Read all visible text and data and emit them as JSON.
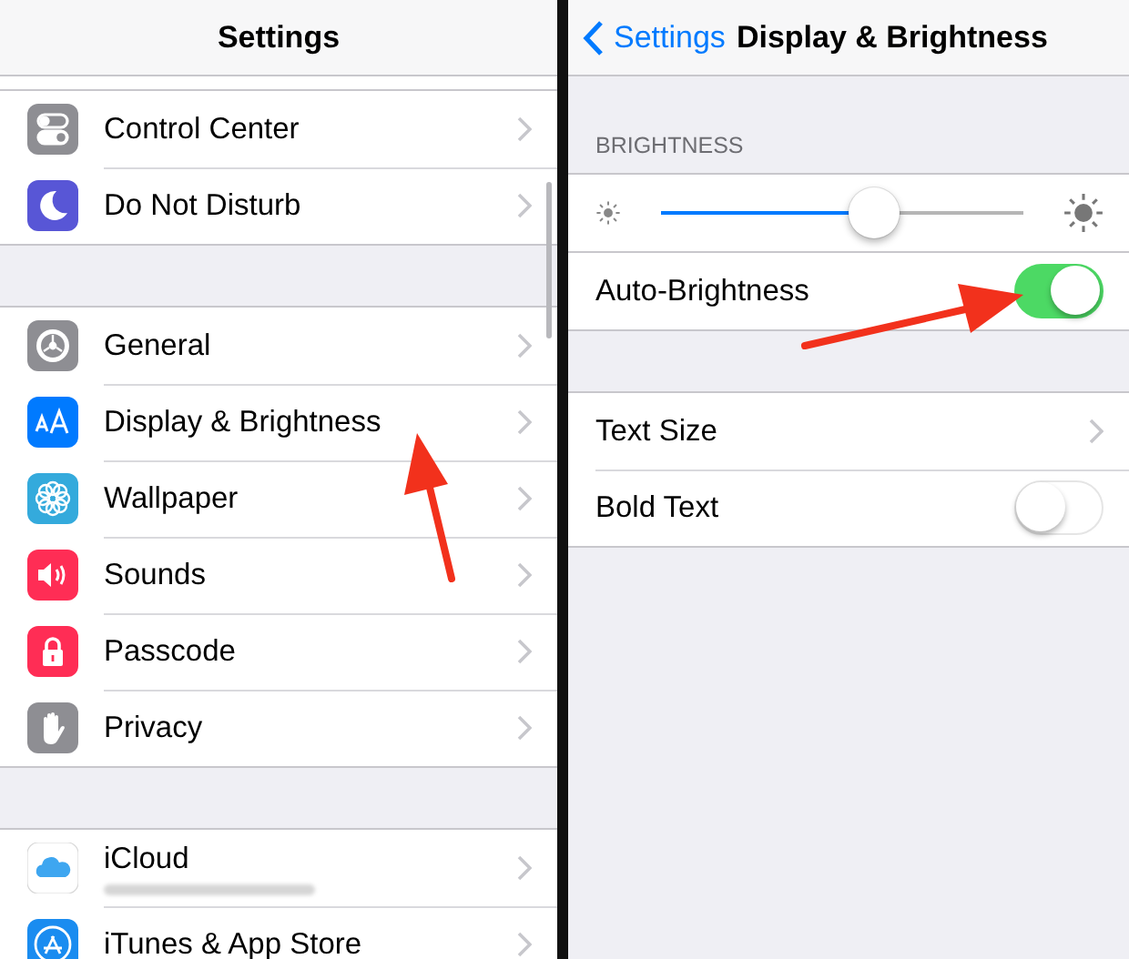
{
  "left_panel": {
    "title": "Settings",
    "groups": [
      [
        {
          "label": "Control Center"
        },
        {
          "label": "Do Not Disturb"
        }
      ],
      [
        {
          "label": "General"
        },
        {
          "label": "Display & Brightness"
        },
        {
          "label": "Wallpaper"
        },
        {
          "label": "Sounds"
        },
        {
          "label": "Passcode"
        },
        {
          "label": "Privacy"
        }
      ],
      [
        {
          "label": "iCloud",
          "redacted_subtitle": true
        },
        {
          "label": "iTunes & App Store"
        }
      ]
    ]
  },
  "right_panel": {
    "back": "Settings",
    "title": "Display & Brightness",
    "section": "BRIGHTNESS",
    "brightness": {
      "level": 0.59
    },
    "groups": [
      [
        {
          "kind": "toggle",
          "label": "Auto-Brightness",
          "on": true
        }
      ],
      [
        {
          "kind": "disclosure",
          "label": "Text Size"
        },
        {
          "kind": "toggle",
          "label": "Bold Text",
          "on": false
        }
      ]
    ]
  }
}
